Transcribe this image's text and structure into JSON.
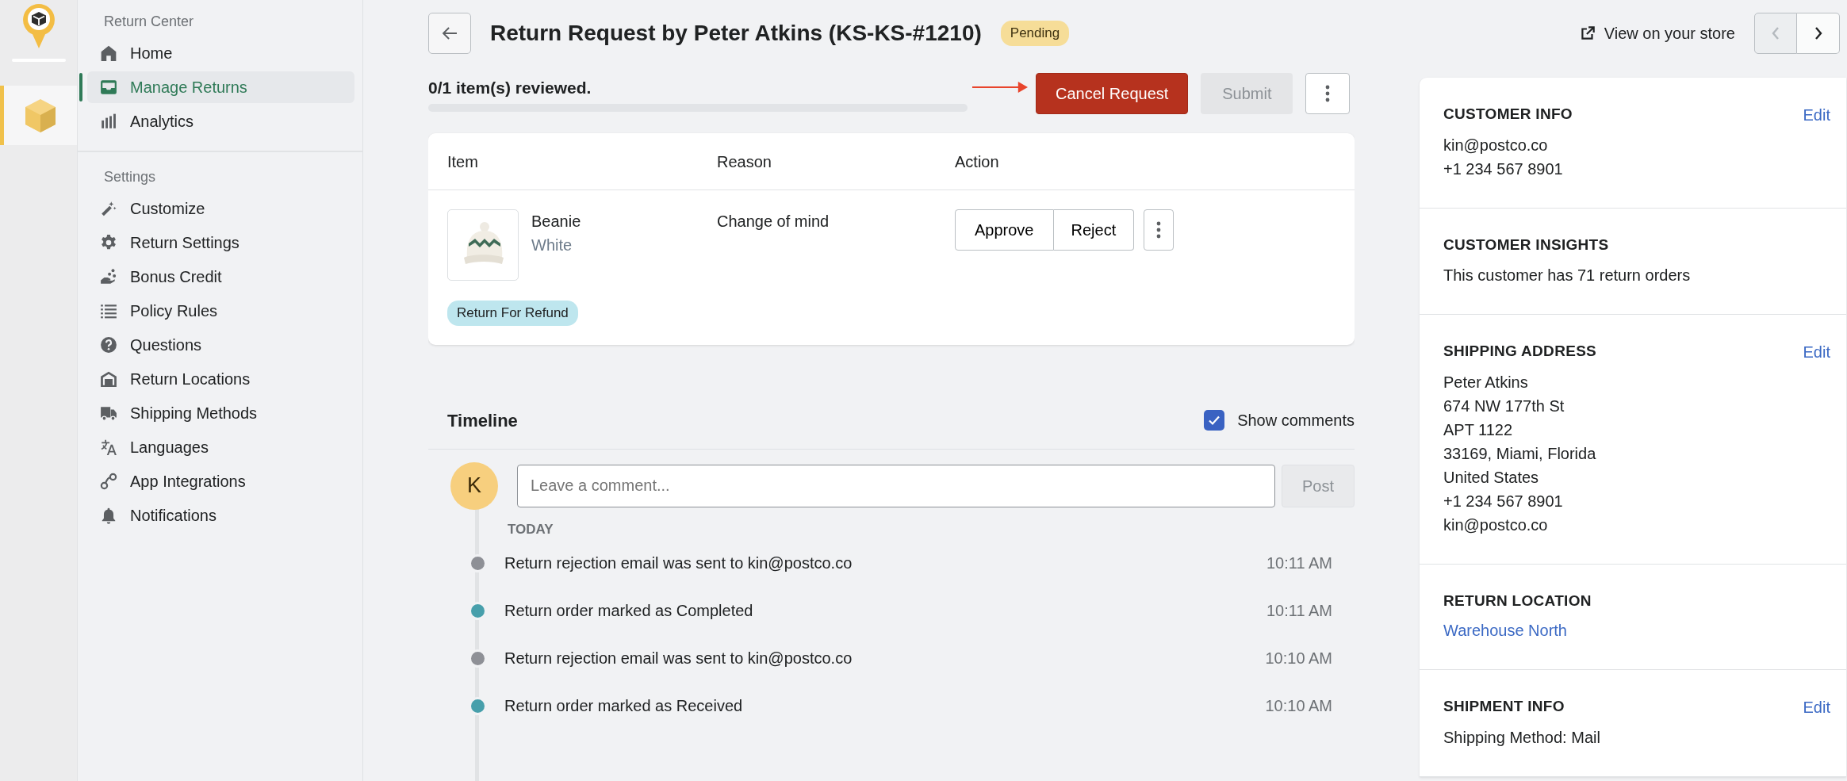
{
  "rail": {
    "apps": [
      {
        "selected": true
      }
    ]
  },
  "sidebar": {
    "sections": [
      {
        "title": "Return Center",
        "items": [
          {
            "label": "Home",
            "selected": false
          },
          {
            "label": "Manage Returns",
            "selected": true
          },
          {
            "label": "Analytics",
            "selected": false
          }
        ]
      },
      {
        "title": "Settings",
        "items": [
          {
            "label": "Customize",
            "selected": false
          },
          {
            "label": "Return Settings",
            "selected": false
          },
          {
            "label": "Bonus Credit",
            "selected": false
          },
          {
            "label": "Policy Rules",
            "selected": false
          },
          {
            "label": "Questions",
            "selected": false
          },
          {
            "label": "Return Locations",
            "selected": false
          },
          {
            "label": "Shipping Methods",
            "selected": false
          },
          {
            "label": "Languages",
            "selected": false
          },
          {
            "label": "App Integrations",
            "selected": false
          },
          {
            "label": "Notifications",
            "selected": false
          }
        ]
      }
    ]
  },
  "header": {
    "title": "Return Request by Peter Atkins (KS-KS-#1210)",
    "status": "Pending",
    "view_store": "View on your store",
    "pager": [
      {
        "kind": "prev",
        "disabled": true
      },
      {
        "kind": "next",
        "disabled": false
      }
    ]
  },
  "progress": {
    "text": "0/1 item(s) reviewed.",
    "level": 0
  },
  "actions": [
    {
      "kind": "danger",
      "label": "Cancel Request",
      "disabled": false
    },
    {
      "kind": "secondary",
      "label": "Submit",
      "disabled": true
    },
    {
      "kind": "more"
    }
  ],
  "items_table": {
    "columns": [
      "Item",
      "Reason",
      "Action"
    ],
    "rows": [
      {
        "name": "Beanie",
        "variant": "White",
        "reason": "Change of mind",
        "tag": "Return For Refund",
        "buttons": [
          "Approve",
          "Reject"
        ]
      }
    ]
  },
  "timeline": {
    "title": "Timeline",
    "show_comments": {
      "label": "Show comments",
      "checked": true
    },
    "avatar": "K",
    "comment": {
      "placeholder": "Leave a comment...",
      "button": "Post",
      "disabled": true
    },
    "groups": [
      {
        "date": "TODAY",
        "events": [
          {
            "text": "Return rejection email was sent to kin@postco.co",
            "time": "10:11 AM",
            "color": "#8e9096"
          },
          {
            "text": "Return order marked as Completed",
            "time": "10:11 AM",
            "color": "#479fab"
          },
          {
            "text": "Return rejection email was sent to kin@postco.co",
            "time": "10:10 AM",
            "color": "#8e9096"
          },
          {
            "text": "Return order marked as Received",
            "time": "10:10 AM",
            "color": "#479fab"
          }
        ]
      }
    ]
  },
  "panel": {
    "sections": [
      {
        "title": "CUSTOMER INFO",
        "edit": "Edit",
        "lines": [
          "kin@postco.co",
          "+1 234 567 8901"
        ]
      },
      {
        "title": "CUSTOMER INSIGHTS",
        "lines": [
          "This customer has 71 return orders"
        ]
      },
      {
        "title": "SHIPPING ADDRESS",
        "edit": "Edit",
        "lines": [
          "Peter Atkins",
          "674 NW 177th St",
          "APT 1122",
          "33169, Miami, Florida",
          "United States",
          "+1 234 567 8901",
          "kin@postco.co"
        ]
      },
      {
        "title": "RETURN LOCATION",
        "link": "Warehouse North"
      },
      {
        "title": "SHIPMENT INFO",
        "edit": "Edit",
        "lines": [
          "Shipping Method: Mail"
        ]
      }
    ]
  }
}
